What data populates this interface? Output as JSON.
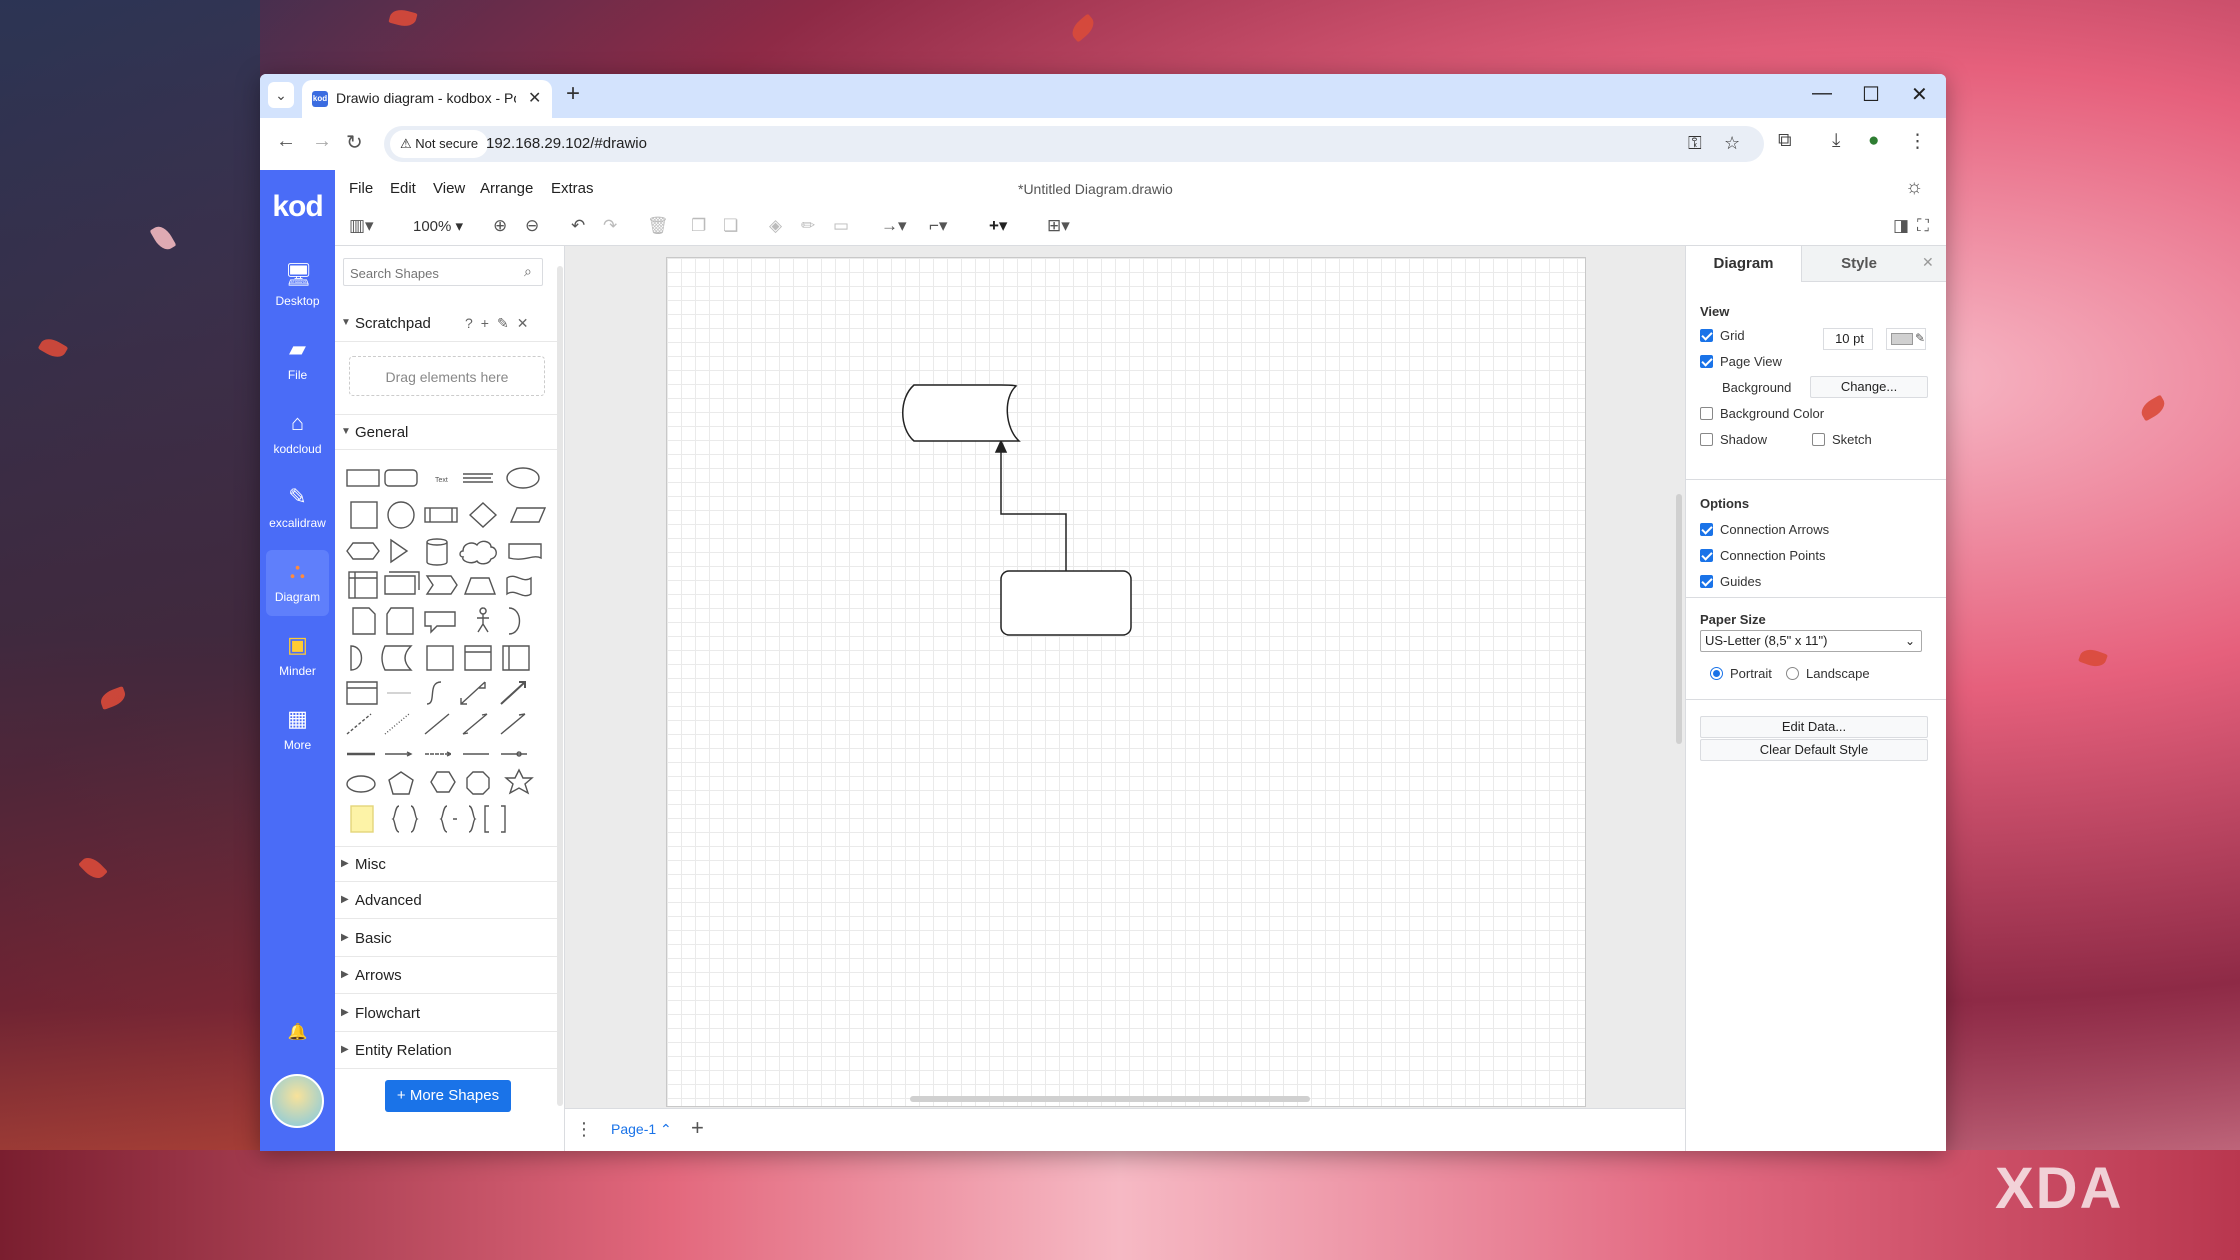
{
  "browser": {
    "tab_title": "Drawio diagram - kodbox - Pow",
    "favicon_text": "kod",
    "security_label": "Not secure",
    "url": "192.168.29.102/#drawio"
  },
  "rail": {
    "logo": "kod",
    "items": [
      {
        "label": "Desktop",
        "icon": "desktop-icon"
      },
      {
        "label": "File",
        "icon": "folder-icon"
      },
      {
        "label": "kodcloud",
        "icon": "home-icon"
      },
      {
        "label": "excalidraw",
        "icon": "excalidraw-icon"
      },
      {
        "label": "Diagram",
        "icon": "diagram-icon"
      },
      {
        "label": "Minder",
        "icon": "minder-icon"
      },
      {
        "label": "More",
        "icon": "grid-icon"
      }
    ]
  },
  "menu": {
    "items": [
      "File",
      "Edit",
      "View",
      "Arrange",
      "Extras"
    ],
    "doc_title": "*Untitled Diagram.drawio"
  },
  "toolbar": {
    "zoom": "100%"
  },
  "shapes": {
    "search_placeholder": "Search Shapes",
    "scratchpad": "Scratchpad",
    "dropzone": "Drag elements here",
    "general": "General",
    "text_shape_label": "Text",
    "sections": [
      "Misc",
      "Advanced",
      "Basic",
      "Arrows",
      "Flowchart",
      "Entity Relation"
    ],
    "more_shapes": "+ More Shapes"
  },
  "pagebar": {
    "page": "Page-1"
  },
  "format": {
    "tabs": [
      "Diagram",
      "Style"
    ],
    "view_title": "View",
    "grid": {
      "label": "Grid",
      "checked": true,
      "size": "10 pt"
    },
    "page_view": {
      "label": "Page View",
      "checked": true
    },
    "background": {
      "label": "Background",
      "button": "Change..."
    },
    "background_color": {
      "label": "Background Color",
      "checked": false
    },
    "shadow": {
      "label": "Shadow",
      "checked": false
    },
    "sketch": {
      "label": "Sketch",
      "checked": false
    },
    "options_title": "Options",
    "connection_arrows": {
      "label": "Connection Arrows",
      "checked": true
    },
    "connection_points": {
      "label": "Connection Points",
      "checked": true
    },
    "guides": {
      "label": "Guides",
      "checked": true
    },
    "paper_title": "Paper Size",
    "paper_size": "US-Letter (8,5\" x 11\")",
    "portrait": "Portrait",
    "landscape": "Landscape",
    "edit_data": "Edit Data...",
    "clear_style": "Clear Default Style"
  },
  "watermark": "XDA"
}
